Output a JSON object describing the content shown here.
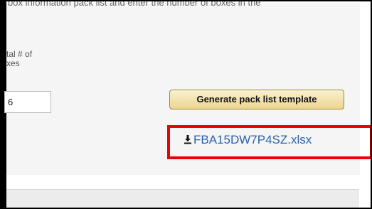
{
  "instructions": {
    "text": "box information pack list and enter the number of boxes in the"
  },
  "total_boxes": {
    "label_line1": "tal # of",
    "label_line2": "xes",
    "value": "6"
  },
  "generate_button": {
    "label": "Generate pack list template"
  },
  "download": {
    "filename": "FBA15DW7P4SZ.xlsx",
    "icon": "download-icon"
  },
  "colors": {
    "highlight": "#ee0000",
    "link": "#2a63a8",
    "button_border": "#a88734"
  }
}
